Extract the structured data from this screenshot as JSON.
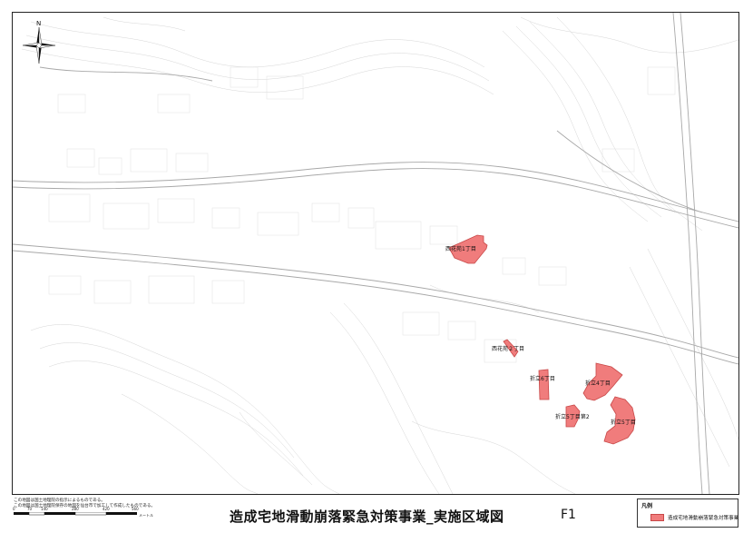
{
  "map": {
    "compass_label": "N",
    "feature_color": "#f07c7c",
    "feature_stroke": "#c84848",
    "areas": [
      {
        "label": "西花苑1丁目"
      },
      {
        "label": "西花苑２丁目"
      },
      {
        "label": "折立6丁目"
      },
      {
        "label": "折立4丁目"
      },
      {
        "label": "折立5丁目第2"
      },
      {
        "label": "折立5丁目"
      }
    ]
  },
  "footer": {
    "notes": [
      "この地図は国土地理院の指示によるものである。",
      "この地図は国土地理院保存の地図を仙台市で加工して作成したものである。"
    ],
    "scale_ticks": [
      "0",
      "70",
      "140",
      "280",
      "420",
      "560"
    ],
    "scale_unit": "メートル",
    "title": "造成宅地滑動崩落緊急対策事業_実施区域図",
    "figure_no": "F1"
  },
  "legend": {
    "title": "凡例",
    "items": [
      {
        "label": "造成宅地滑動崩落緊急対策事業",
        "color": "#f07c7c"
      }
    ]
  }
}
